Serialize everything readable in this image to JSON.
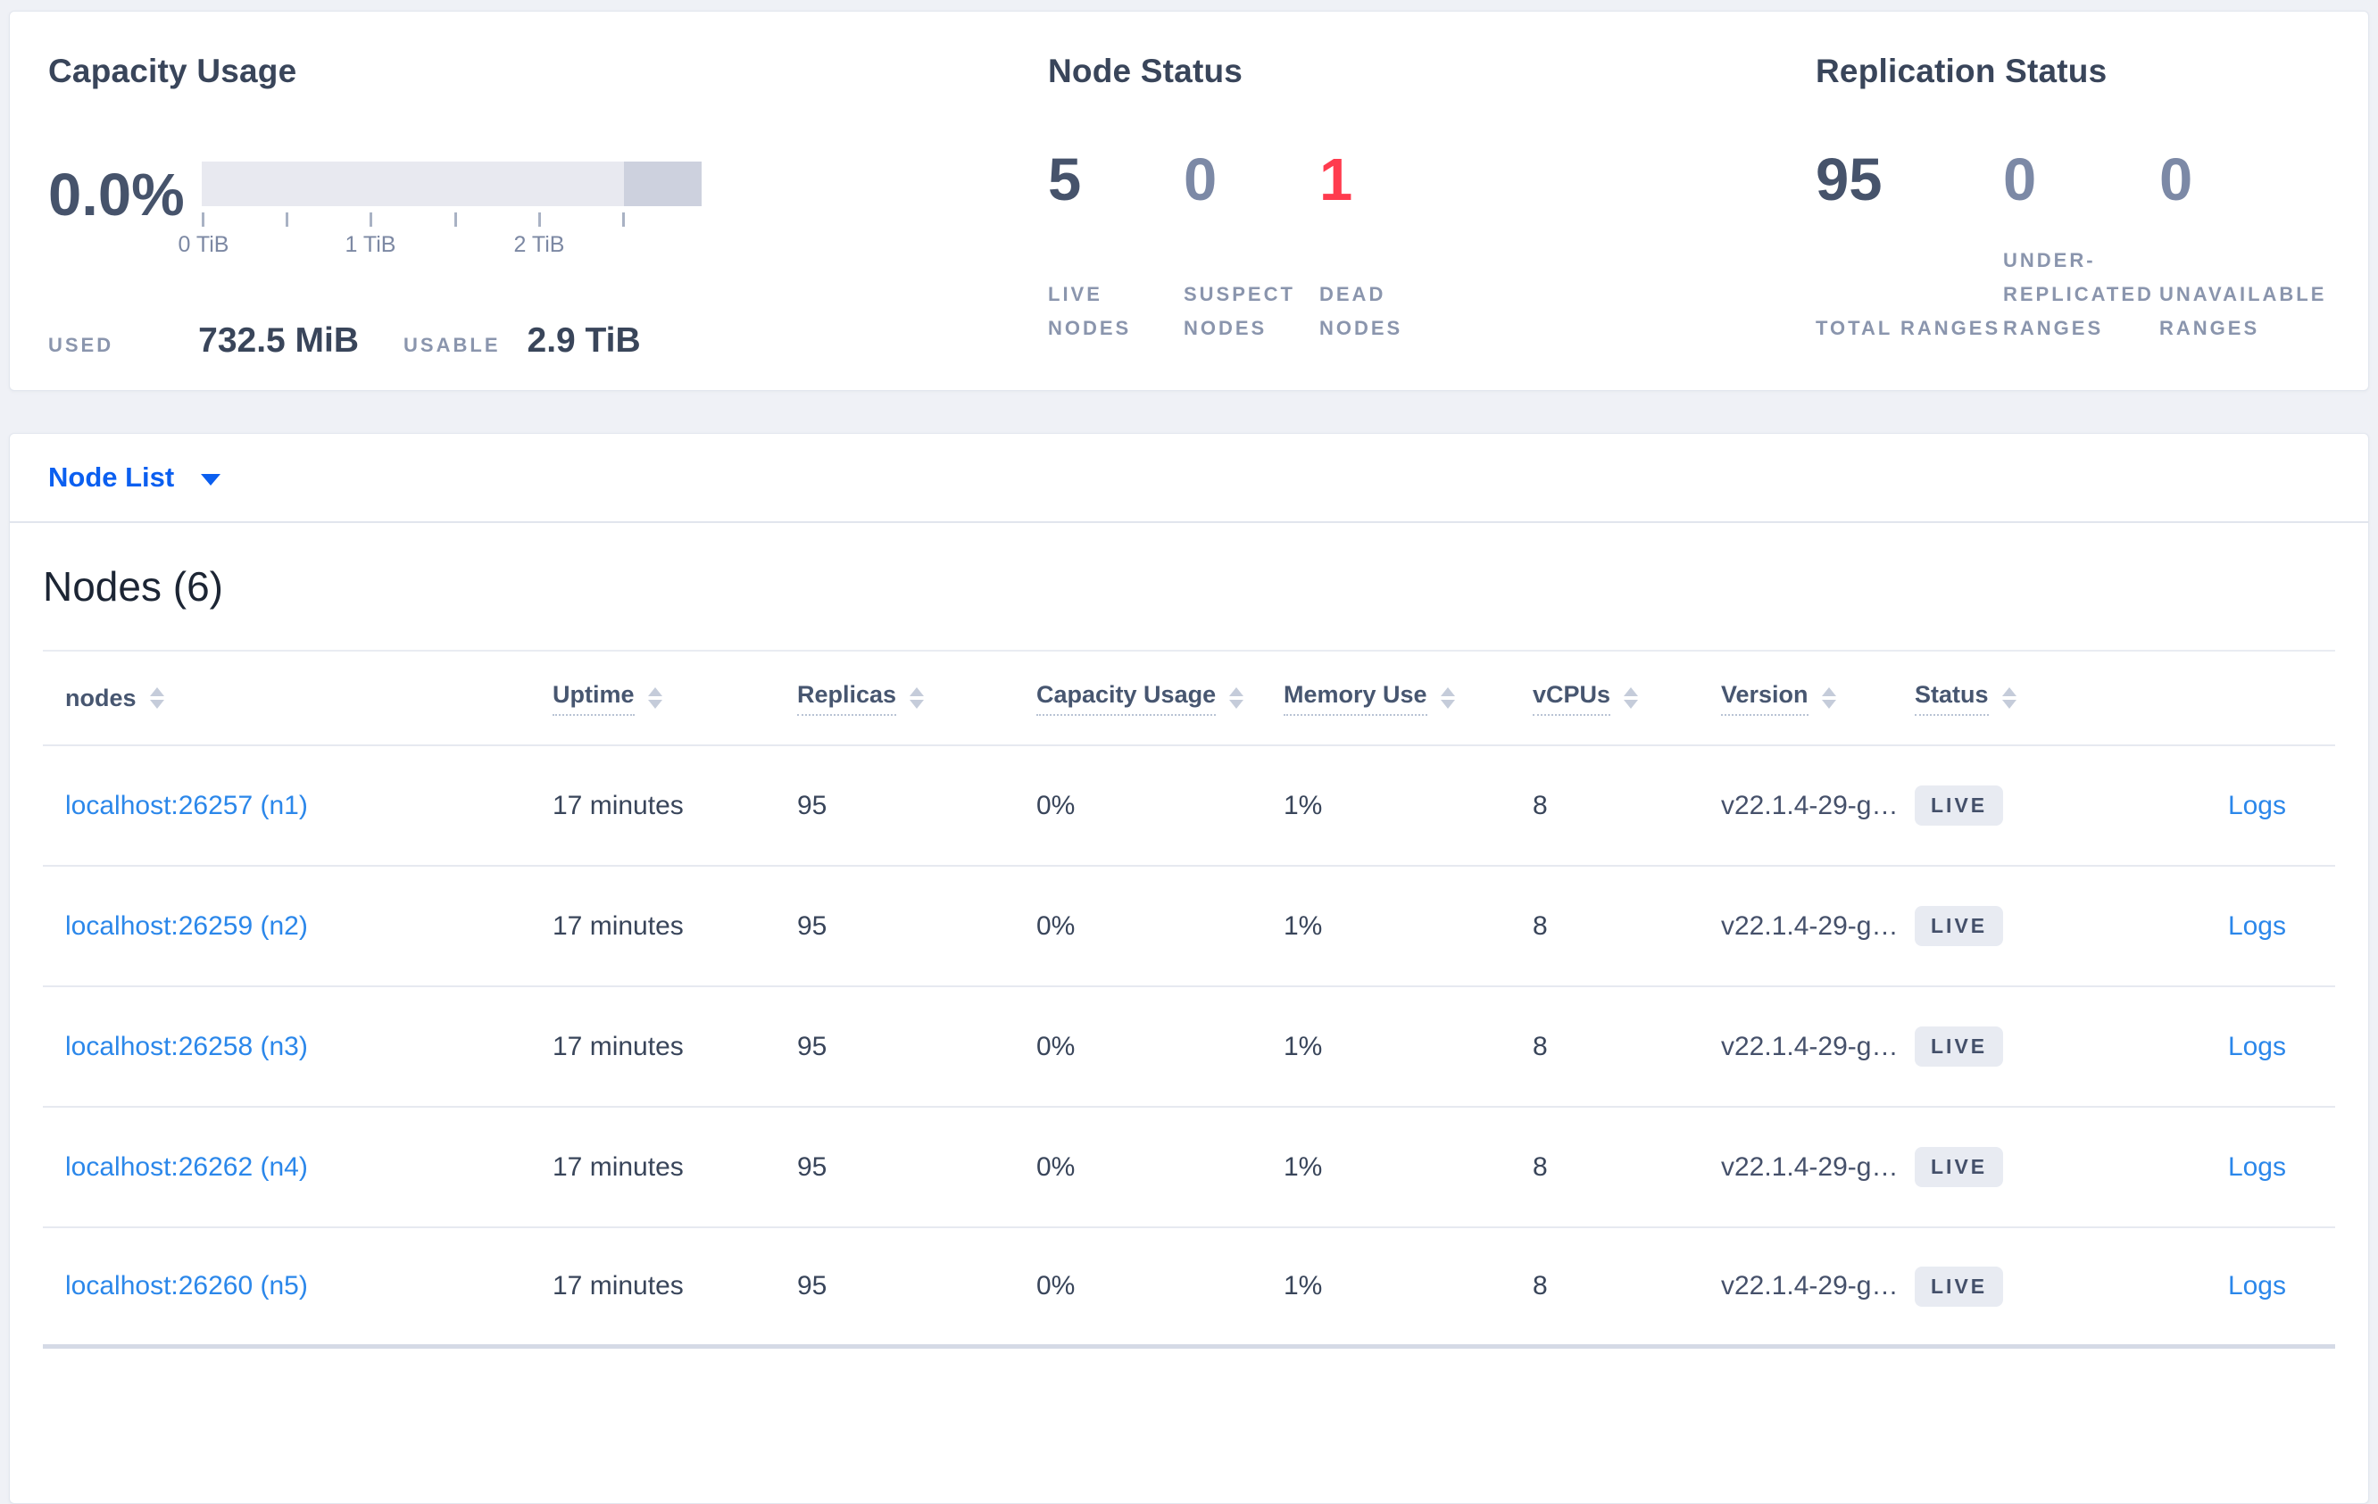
{
  "colors": {
    "accent_blue": "#0b5ff0",
    "link_blue": "#2b87ea",
    "dead_red": "#ff3b4e",
    "stat_dark": "#46536b",
    "stat_muted": "#7c89a6",
    "badge_bg": "#e8ebf2",
    "gauge_light": "#e8e9f0",
    "gauge_dark": "#cdd1de"
  },
  "summary": {
    "capacity": {
      "title": "Capacity Usage",
      "percent": "0.0%",
      "tick_labels": [
        "0 TiB",
        "1 TiB",
        "2 TiB"
      ],
      "used_label": "USED",
      "used_value": "732.5 MiB",
      "usable_label": "USABLE",
      "usable_value": "2.9 TiB"
    },
    "node_status": {
      "title": "Node Status",
      "stats": [
        {
          "value": "5",
          "label": "LIVE NODES",
          "tone": "dark"
        },
        {
          "value": "0",
          "label": "SUSPECT NODES",
          "tone": "muted"
        },
        {
          "value": "1",
          "label": "DEAD NODES",
          "tone": "dead"
        }
      ]
    },
    "replication_status": {
      "title": "Replication Status",
      "stats": [
        {
          "value": "95",
          "label": "TOTAL RANGES",
          "tone": "dark"
        },
        {
          "value": "0",
          "label": "UNDER-REPLICATED RANGES",
          "tone": "muted"
        },
        {
          "value": "0",
          "label": "UNAVAILABLE RANGES",
          "tone": "muted"
        }
      ]
    }
  },
  "view_selector": {
    "label": "Node List"
  },
  "nodes_section": {
    "title": "Nodes (6)",
    "columns": [
      {
        "label": "nodes"
      },
      {
        "label": "Uptime"
      },
      {
        "label": "Replicas"
      },
      {
        "label": "Capacity Usage"
      },
      {
        "label": "Memory Use"
      },
      {
        "label": "vCPUs"
      },
      {
        "label": "Version"
      },
      {
        "label": "Status"
      }
    ],
    "rows": [
      {
        "address": "localhost:26257 (n1)",
        "uptime": "17 minutes",
        "replicas": "95",
        "capacity_usage": "0%",
        "memory_use": "1%",
        "vcpus": "8",
        "version": "v22.1.4-29-g…",
        "status": "LIVE",
        "logs": "Logs"
      },
      {
        "address": "localhost:26259 (n2)",
        "uptime": "17 minutes",
        "replicas": "95",
        "capacity_usage": "0%",
        "memory_use": "1%",
        "vcpus": "8",
        "version": "v22.1.4-29-g…",
        "status": "LIVE",
        "logs": "Logs"
      },
      {
        "address": "localhost:26258 (n3)",
        "uptime": "17 minutes",
        "replicas": "95",
        "capacity_usage": "0%",
        "memory_use": "1%",
        "vcpus": "8",
        "version": "v22.1.4-29-g…",
        "status": "LIVE",
        "logs": "Logs"
      },
      {
        "address": "localhost:26262 (n4)",
        "uptime": "17 minutes",
        "replicas": "95",
        "capacity_usage": "0%",
        "memory_use": "1%",
        "vcpus": "8",
        "version": "v22.1.4-29-g…",
        "status": "LIVE",
        "logs": "Logs"
      },
      {
        "address": "localhost:26260 (n5)",
        "uptime": "17 minutes",
        "replicas": "95",
        "capacity_usage": "0%",
        "memory_use": "1%",
        "vcpus": "8",
        "version": "v22.1.4-29-g…",
        "status": "LIVE",
        "logs": "Logs"
      }
    ]
  }
}
